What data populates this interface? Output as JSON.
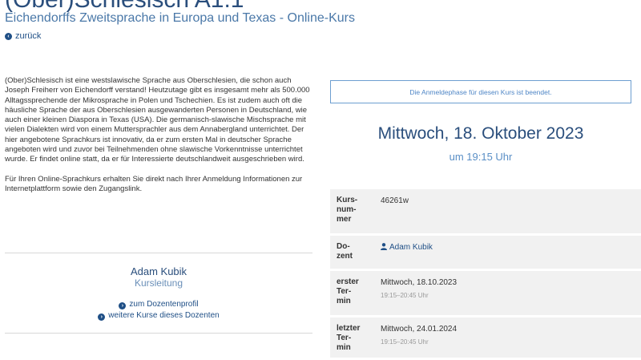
{
  "course": {
    "title": "(Ober)Schlesisch A1.1",
    "subtitle": "Eichendorffs Zweitsprache in Europa und Texas - Online-Kurs",
    "back_label": "zurück"
  },
  "description": {
    "paragraph1": "(Ober)Schlesisch ist eine westslawische Sprache aus Oberschlesien, die schon auch Joseph Freiherr von Eichendorff verstand! Heutzutage gibt es insgesamt mehr als 500.000 Alltagssprechende der Mikrosprache in Polen und Tschechien. Es ist zudem auch oft die häusliche Sprache der aus Oberschlesien ausgewanderten Personen in Deutschland, wie auch einer kleinen Diaspora in Texas (USA). Die germanisch-slawische Mischsprache mit vielen Dialekten wird von einem Muttersprachler aus dem Annaberg­land unterrichtet. Der hier angebotene Sprachkurs ist innovativ, da er zum ersten Mal in deutscher Sprache angeboten wird und zuvor bei Teilnehmenden ohne slawische Vorkenntnisse unterrichtet wurde. Er findet online statt, da er für In­teressierte deutschlandweit ausgeschrieben wird.",
    "paragraph2": "Für Ihren Online-Sprachkurs erhalten Sie direkt nach Ihrer Anmeldung Informationen zur Internetplattform sowie den Zugangslink."
  },
  "teacher": {
    "name": "Adam Kubik",
    "role": "Kursleitung",
    "profile_link": "zum Dozentenprofil",
    "more_courses_link": "weitere Kurse dieses Dozenten"
  },
  "registration_notice": "Die Anmeldephase für diesen Kurs ist beendet.",
  "start": {
    "date": "Mittwoch, 18. Oktober 2023",
    "time": "um 19:15 Uhr"
  },
  "info": {
    "course_number_label": "Kurs-\nnum-\nmer",
    "course_number": "46261w",
    "lecturer_label": "Do-\nzent",
    "lecturer": "Adam Kubik",
    "first_label": "erster\nTer-\nmin",
    "first_date": "Mittwoch, 18.10.2023",
    "first_time": "19:15–20:45 Uhr",
    "last_label": "letzter\nTer-\nmin",
    "last_date": "Mittwoch, 24.01.2024",
    "last_time": "19:15–20:45 Uhr"
  },
  "icons": {
    "back": "chevron-left-circle-icon",
    "link": "chevron-right-circle-icon",
    "user": "user-icon"
  },
  "colors": {
    "title": "#2a4e7c",
    "accent": "#4f86c6",
    "table_bg": "#f1f1f1"
  }
}
